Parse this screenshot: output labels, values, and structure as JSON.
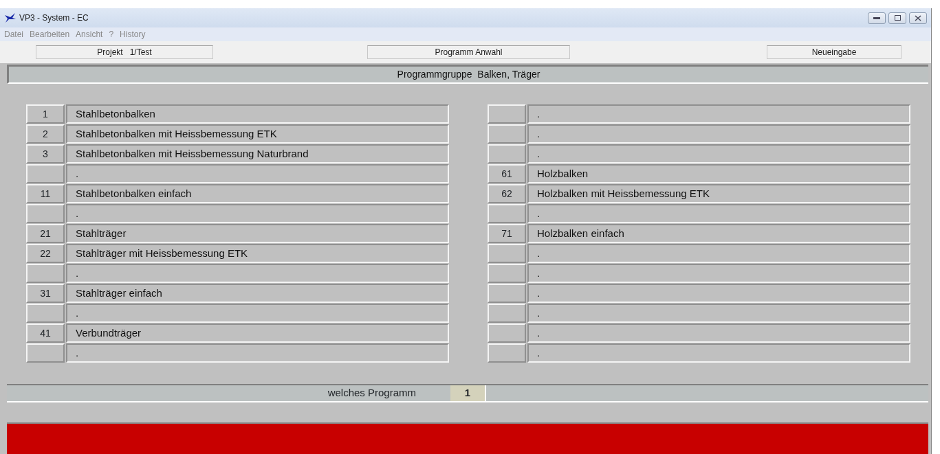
{
  "window": {
    "title": "VP3 - System - EC"
  },
  "menu": [
    "Datei",
    "Bearbeiten",
    "Ansicht",
    "?",
    "History"
  ],
  "header": {
    "project": "Projekt   1/Test",
    "mode": "Programm Anwahl",
    "status": "Neueingabe"
  },
  "group_title": "Programmgruppe  Balken, Träger",
  "left_programs": [
    {
      "number": "1",
      "label": "Stahlbetonbalken"
    },
    {
      "number": "2",
      "label": "Stahlbetonbalken mit Heissbemessung ETK"
    },
    {
      "number": "3",
      "label": "Stahlbetonbalken mit Heissbemessung Naturbrand"
    },
    {
      "label": "."
    },
    {
      "number": "11",
      "label": "Stahlbetonbalken einfach"
    },
    {
      "label": "."
    },
    {
      "number": "21",
      "label": "Stahlträger"
    },
    {
      "number": "22",
      "label": "Stahlträger mit Heissbemessung ETK"
    },
    {
      "label": "."
    },
    {
      "number": "31",
      "label": "Stahlträger einfach"
    },
    {
      "label": "."
    },
    {
      "number": "41",
      "label": "Verbundträger"
    },
    {
      "label": "."
    }
  ],
  "right_programs": [
    {
      "label": "."
    },
    {
      "label": "."
    },
    {
      "label": "."
    },
    {
      "number": "61",
      "label": "Holzbalken"
    },
    {
      "number": "62",
      "label": "Holzbalken mit Heissbemessung ETK"
    },
    {
      "label": "."
    },
    {
      "number": "71",
      "label": "Holzbalken einfach"
    },
    {
      "label": "."
    },
    {
      "label": "."
    },
    {
      "label": "."
    },
    {
      "label": "."
    },
    {
      "label": "."
    },
    {
      "label": "."
    }
  ],
  "prompt": {
    "label": "welches Programm",
    "value": "1"
  }
}
